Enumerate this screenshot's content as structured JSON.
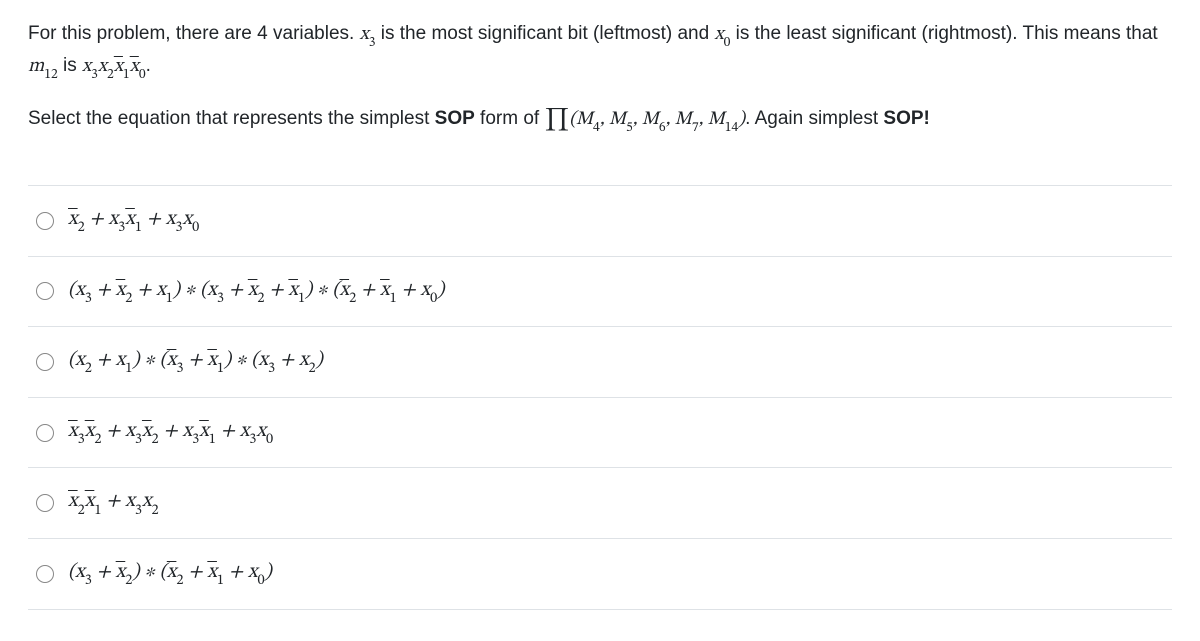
{
  "question": {
    "p1_html": "For this problem, there are 4 variables. <span class='math'>x<span class='sub'>3</span></span> is the most significant bit (leftmost) and <span class='math'>x<span class='sub'>0</span></span> is the least significant (rightmost). This means that <span class='math'>m<span class='sub'>12</span></span> is <span class='math'>x<span class='sub'>3</span>x<span class='sub'>2</span><span class='bar'>x</span><span class='sub'>1</span><span class='bar'>x</span><span class='sub'>0</span></span>.",
    "p2_html": "Select the equation that represents the simplest <strong>SOP</strong> form of <span class='math'><span class='prod'>∏</span>(M<span class='sub'>4</span>, M<span class='sub'>5</span>, M<span class='sub'>6</span>, M<span class='sub'>7</span>, M<span class='sub'>14</span>)</span>. Again simplest <strong>SOP!</strong>"
  },
  "options": [
    {
      "html": "<span class='bar'>x</span><span class='sub'>2</span> + x<span class='sub'>3</span><span class='bar'>x</span><span class='sub'>1</span> + x<span class='sub'>3</span>x<span class='sub'>0</span>"
    },
    {
      "html": "(x<span class='sub'>3</span> + <span class='bar'>x</span><span class='sub'>2</span> + x<span class='sub'>1</span>) ∗ (x<span class='sub'>3</span> + <span class='bar'>x</span><span class='sub'>2</span> + <span class='bar'>x</span><span class='sub'>1</span>) ∗ (<span class='bar'>x</span><span class='sub'>2</span> + <span class='bar'>x</span><span class='sub'>1</span> + x<span class='sub'>0</span>)"
    },
    {
      "html": "(x<span class='sub'>2</span> + x<span class='sub'>1</span>) ∗ (<span class='bar'>x</span><span class='sub'>3</span> + <span class='bar'>x</span><span class='sub'>1</span>) ∗ (x<span class='sub'>3</span> + x<span class='sub'>2</span>)"
    },
    {
      "html": "<span class='bar'>x</span><span class='sub'>3</span><span class='bar'>x</span><span class='sub'>2</span> + x<span class='sub'>3</span><span class='bar'>x</span><span class='sub'>2</span> + x<span class='sub'>3</span><span class='bar'>x</span><span class='sub'>1</span> + x<span class='sub'>3</span>x<span class='sub'>0</span>"
    },
    {
      "html": "<span class='bar'>x</span><span class='sub'>2</span><span class='bar'>x</span><span class='sub'>1</span> + x<span class='sub'>3</span>x<span class='sub'>2</span>"
    },
    {
      "html": "(x<span class='sub'>3</span> + <span class='bar'>x</span><span class='sub'>2</span>) ∗ (<span class='bar'>x</span><span class='sub'>2</span> + <span class='bar'>x</span><span class='sub'>1</span> + x<span class='sub'>0</span>)"
    }
  ]
}
